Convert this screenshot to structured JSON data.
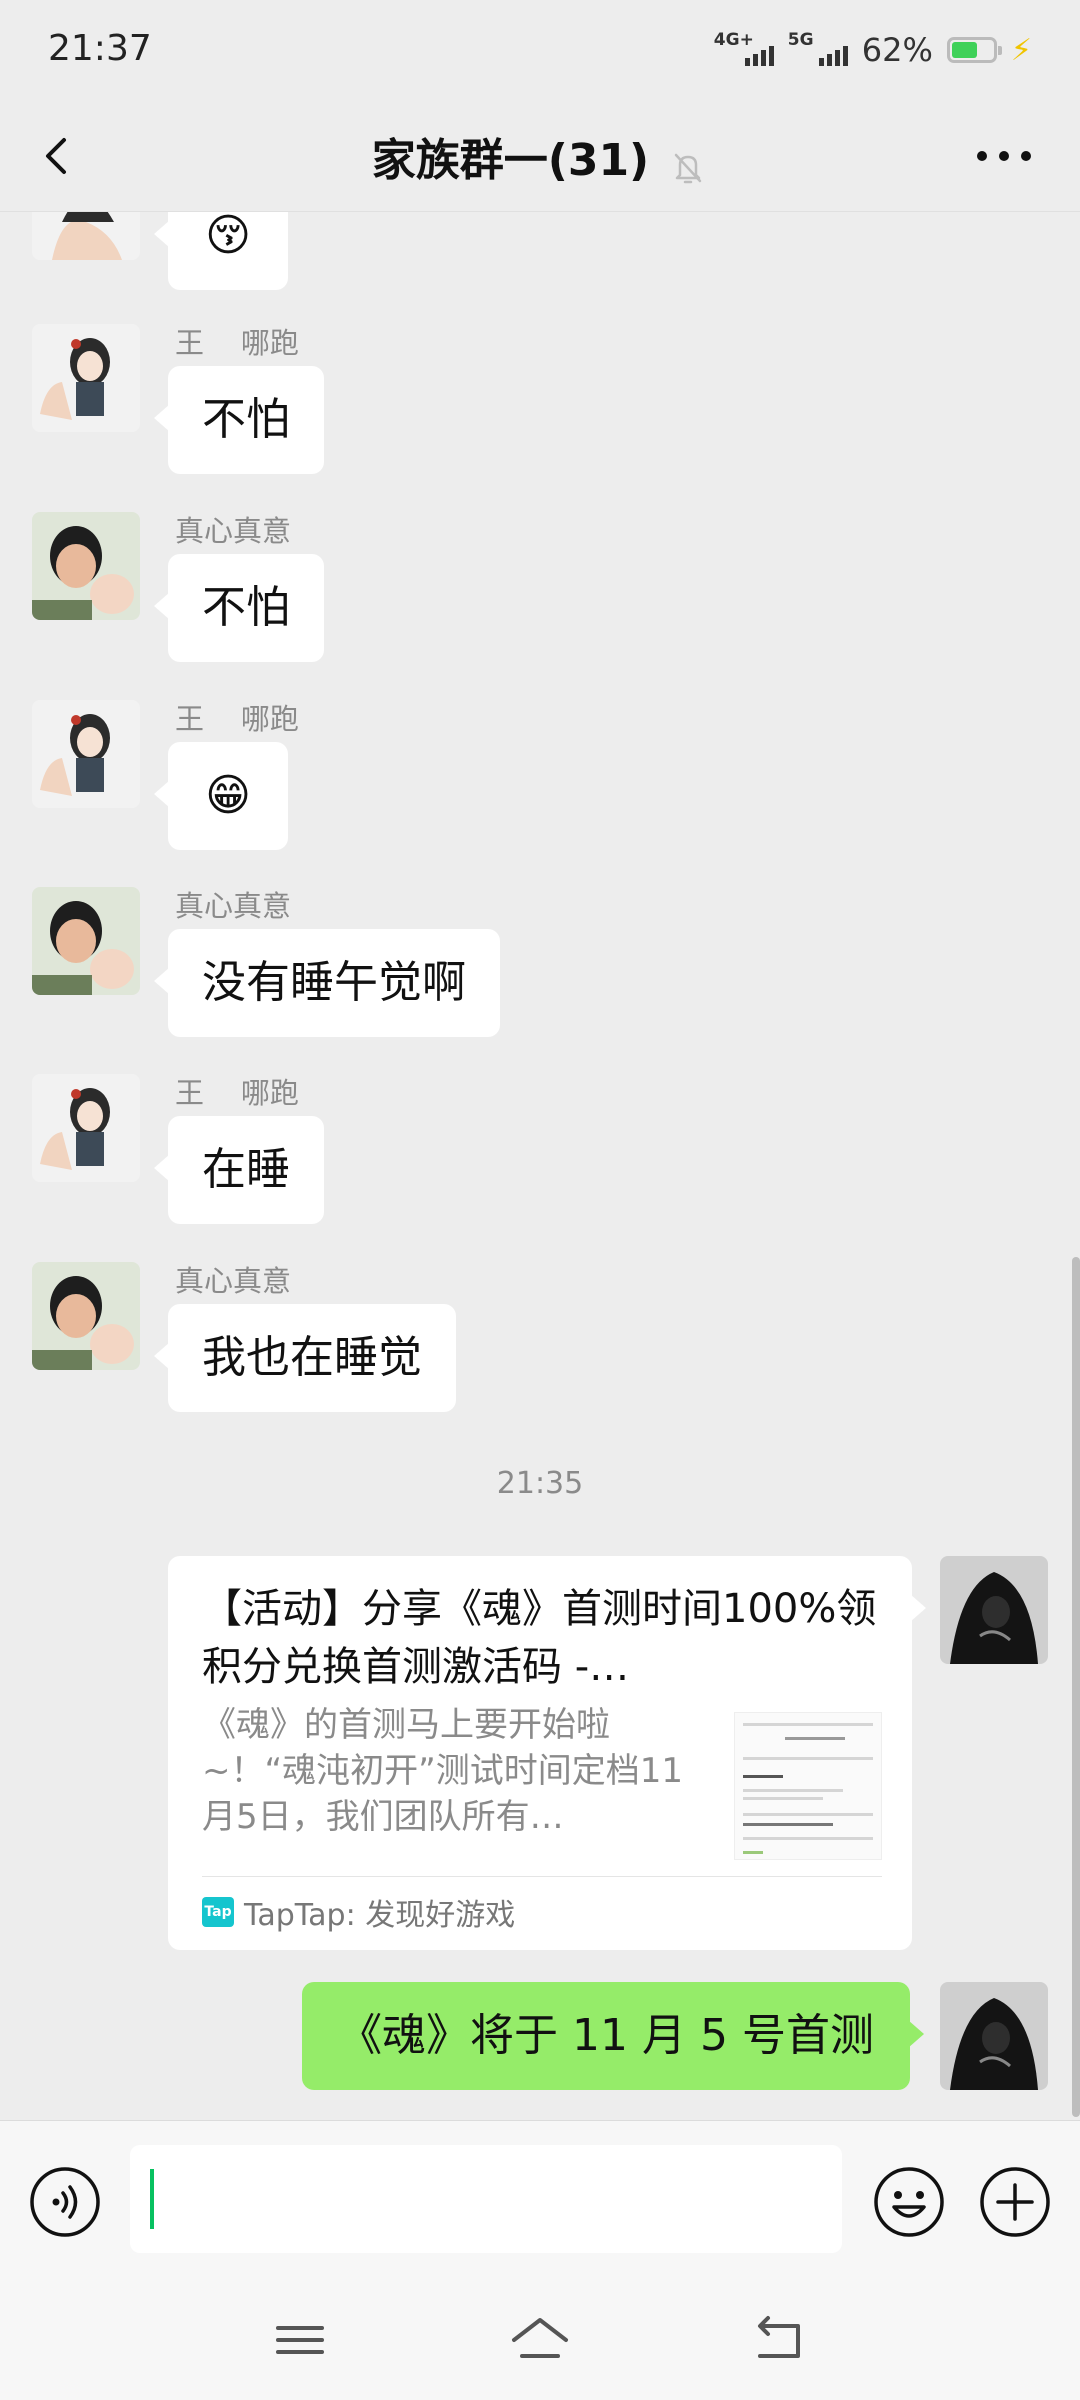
{
  "status_bar": {
    "time": "21:37",
    "network_1": "4G+",
    "network_2": "5G",
    "battery_percent": "62%",
    "battery_level": 0.62,
    "charging_color": "#f0c400"
  },
  "header": {
    "title": "家族群一(31)",
    "back_icon": "chevron-left-icon",
    "mute_icon": "bell-off-icon",
    "more_icon": "more-horizontal-icon"
  },
  "messages": [
    {
      "type": "emoji",
      "sender": "",
      "avatar": "anime-girl-avatar",
      "content": "😚"
    },
    {
      "type": "text",
      "sender": "王    哪跑",
      "avatar": "anime-girl-avatar",
      "content": "不怕"
    },
    {
      "type": "text",
      "sender": "真心真意",
      "avatar": "family-photo-avatar",
      "content": "不怕"
    },
    {
      "type": "emoji",
      "sender": "王    哪跑",
      "avatar": "anime-girl-avatar",
      "content": "😁"
    },
    {
      "type": "text",
      "sender": "真心真意",
      "avatar": "family-photo-avatar",
      "content": "没有睡午觉啊"
    },
    {
      "type": "text",
      "sender": "王    哪跑",
      "avatar": "anime-girl-avatar",
      "content": "在睡"
    },
    {
      "type": "text",
      "sender": "真心真意",
      "avatar": "family-photo-avatar",
      "content": "我也在睡觉"
    }
  ],
  "timestamp": "21:35",
  "link_card": {
    "title": "【活动】分享《魂》首测时间100%领积分兑换首测激活码 -…",
    "description": "《魂》的首测马上要开始啦~！“魂沌初开”测试时间定档11月5日，我们团队所有…",
    "source_logo_text": "Tap",
    "source": "TapTap: 发现好游戏",
    "avatar": "dark-figure-avatar"
  },
  "outgoing_text": {
    "content": "《魂》将于 11 月 5 号首测",
    "avatar": "dark-figure-avatar",
    "bubble_color": "#95ec69"
  },
  "input_bar": {
    "value": "",
    "voice_icon": "voice-icon",
    "emoji_icon": "emoji-icon",
    "plus_icon": "plus-icon",
    "caret_color": "#07c160"
  },
  "nav_bar": {
    "icons": [
      "menu-icon",
      "home-icon",
      "back-icon"
    ]
  }
}
